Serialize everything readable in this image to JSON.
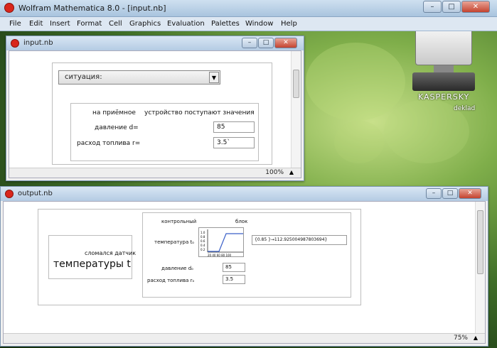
{
  "app": {
    "title": "Wolfram Mathematica 8.0 - [input.nb]",
    "menu": [
      "File",
      "Edit",
      "Insert",
      "Format",
      "Cell",
      "Graphics",
      "Evaluation",
      "Palettes",
      "Window",
      "Help"
    ]
  },
  "desktop": {
    "icon_label": "deklad",
    "icon_brand": "KASPERSKY"
  },
  "input_nb": {
    "title": "input.nb",
    "situation_popup": "ситуация:",
    "header_left": "на приёмное",
    "header_right": "устройство поступают значения",
    "pressure_label": "давление d=",
    "pressure_value": "85",
    "fuel_label": "расход топлива r=",
    "fuel_value": "3.5`",
    "zoom": "100%"
  },
  "output_nb": {
    "title": "output.nb",
    "alert_small": "сломался датчик",
    "alert_big": "температуры t",
    "header_left": "контрольный",
    "header_right": "блок",
    "temp_label": "температура tₒ",
    "temp_result": "{0.85   }→112.925004987803694}",
    "pressure_label": "давление dₒ",
    "pressure_value": "85",
    "fuel_label": "расход топлива rₒ",
    "fuel_value": "3.5",
    "zoom": "75%"
  },
  "colors": {
    "accent_blue": "#1a1ae0",
    "alert_red": "#e0181c"
  }
}
